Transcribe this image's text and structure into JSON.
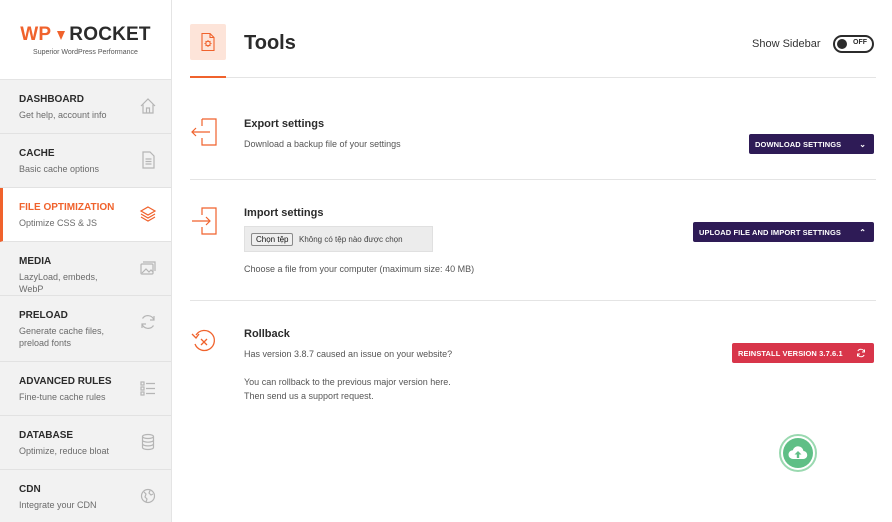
{
  "logo": {
    "wp": "WP",
    "name": "ROCKET",
    "tagline": "Superior WordPress Performance"
  },
  "sidebar": {
    "items": [
      {
        "title": "DASHBOARD",
        "desc": "Get help, account info",
        "icon": "home-icon"
      },
      {
        "title": "CACHE",
        "desc": "Basic cache options",
        "icon": "file-icon"
      },
      {
        "title": "FILE OPTIMIZATION",
        "desc": "Optimize CSS & JS",
        "icon": "layers-icon"
      },
      {
        "title": "MEDIA",
        "desc": "LazyLoad, embeds, WebP",
        "icon": "images-icon"
      },
      {
        "title": "PRELOAD",
        "desc": "Generate cache files, preload fonts",
        "icon": "refresh-icon"
      },
      {
        "title": "ADVANCED RULES",
        "desc": "Fine-tune cache rules",
        "icon": "list-icon"
      },
      {
        "title": "DATABASE",
        "desc": "Optimize, reduce bloat",
        "icon": "database-icon"
      },
      {
        "title": "CDN",
        "desc": "Integrate your CDN",
        "icon": "globe-icon"
      }
    ],
    "active_index": 2
  },
  "header": {
    "title": "Tools",
    "show_sidebar_label": "Show Sidebar",
    "toggle_state": "OFF"
  },
  "export": {
    "title": "Export settings",
    "desc": "Download a backup file of your settings",
    "button": "DOWNLOAD SETTINGS"
  },
  "import": {
    "title": "Import settings",
    "file_button": "Chọn tệp",
    "file_status": "Không có tệp nào được chọn",
    "help": "Choose a file from your computer (maximum size: 40 MB)",
    "button": "UPLOAD FILE AND IMPORT SETTINGS"
  },
  "rollback": {
    "title": "Rollback",
    "question": "Has version 3.8.7 caused an issue on your website?",
    "line1": "You can rollback to the previous major version here.",
    "line2": "Then send us a support request.",
    "button": "REINSTALL VERSION 3.7.6.1"
  },
  "colors": {
    "accent": "#f0622c",
    "dark_button": "#2e1b56",
    "red_button": "#d8354a",
    "fab": "#5fbf86"
  }
}
